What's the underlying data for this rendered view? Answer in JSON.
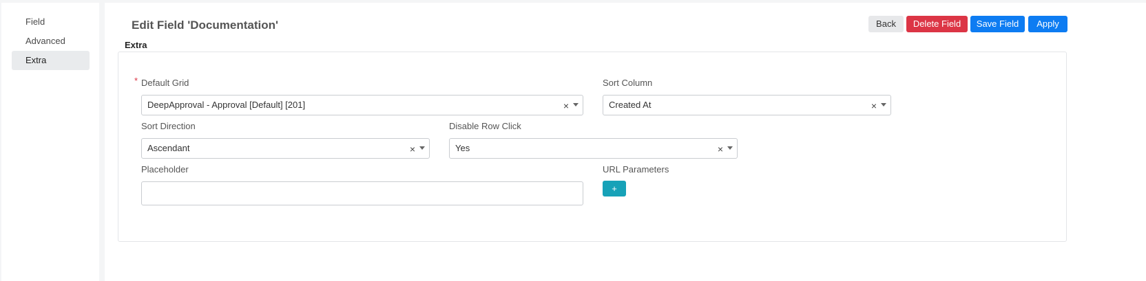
{
  "sidebar": {
    "items": [
      {
        "label": "Field",
        "active": false
      },
      {
        "label": "Advanced",
        "active": false
      },
      {
        "label": "Extra",
        "active": true
      }
    ]
  },
  "header": {
    "title": "Edit Field 'Documentation'",
    "buttons": {
      "back": "Back",
      "delete": "Delete Field",
      "save": "Save Field",
      "apply": "Apply"
    }
  },
  "section": {
    "label": "Extra"
  },
  "form": {
    "required_marker": "*",
    "default_grid": {
      "label": "Default Grid",
      "value": "DeepApproval - Approval [Default] [201]",
      "required": true
    },
    "sort_column": {
      "label": "Sort Column",
      "value": "Created At"
    },
    "sort_direction": {
      "label": "Sort Direction",
      "value": "Ascendant"
    },
    "disable_row_click": {
      "label": "Disable Row Click",
      "value": "Yes"
    },
    "placeholder": {
      "label": "Placeholder",
      "value": ""
    },
    "url_parameters": {
      "label": "URL Parameters",
      "add_label": "+"
    },
    "clear_glyph": "×"
  },
  "colors": {
    "primary": "#0d7cf2",
    "danger": "#dc3545",
    "info": "#17a2b8"
  }
}
